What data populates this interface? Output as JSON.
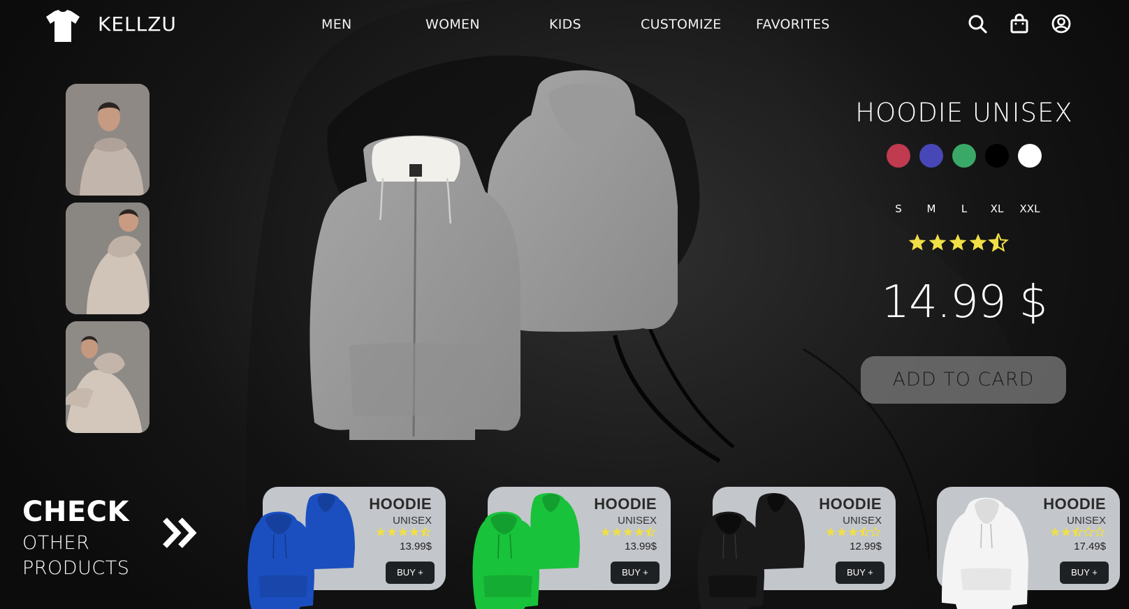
{
  "brand": {
    "name": "KELLZU",
    "logo_icon": "tshirt-icon"
  },
  "nav": {
    "links": [
      "MEN",
      "WOMEN",
      "KIDS",
      "CUSTOMIZE",
      "FAVORITES"
    ],
    "icons": [
      "search-icon",
      "shopping-bag-icon",
      "account-icon"
    ]
  },
  "thumbnails": [
    "model-front-view",
    "model-back-view",
    "model-side-view"
  ],
  "product": {
    "title": "HOODIE UNISEX",
    "colors": [
      "#c03a50",
      "#4747b8",
      "#3aa867",
      "#000000",
      "#ffffff"
    ],
    "sizes": [
      "S",
      "M",
      "L",
      "XL",
      "XXL"
    ],
    "rating": 4.5,
    "price": "14.99 $",
    "add_button": "ADD TO CARD"
  },
  "check": {
    "title": "CHECK",
    "line1": "OTHER",
    "line2": "PRODUCTS",
    "icon": "double-chevron-right-icon"
  },
  "cards": [
    {
      "title": "HOODIE",
      "subtitle": "UNISEX",
      "rating": 4.5,
      "price": "13.99$",
      "button": "BUY +",
      "color": "#1b4fc0"
    },
    {
      "title": "HOODIE",
      "subtitle": "UNISEX",
      "rating": 4.5,
      "price": "13.99$",
      "button": "BUY +",
      "color": "#18c23a"
    },
    {
      "title": "HOODIE",
      "subtitle": "UNISEX",
      "rating": 3.5,
      "price": "12.99$",
      "button": "BUY +",
      "color": "#1a1a1a"
    },
    {
      "title": "HOODIE",
      "subtitle": "UNISEX",
      "rating": 2.5,
      "price": "17.49$",
      "button": "BUY +",
      "color": "#f4f4f4"
    }
  ],
  "colors": {
    "star": "#f0df46",
    "card_bg": "#c3c6cb",
    "button_dark": "#1e2123"
  }
}
